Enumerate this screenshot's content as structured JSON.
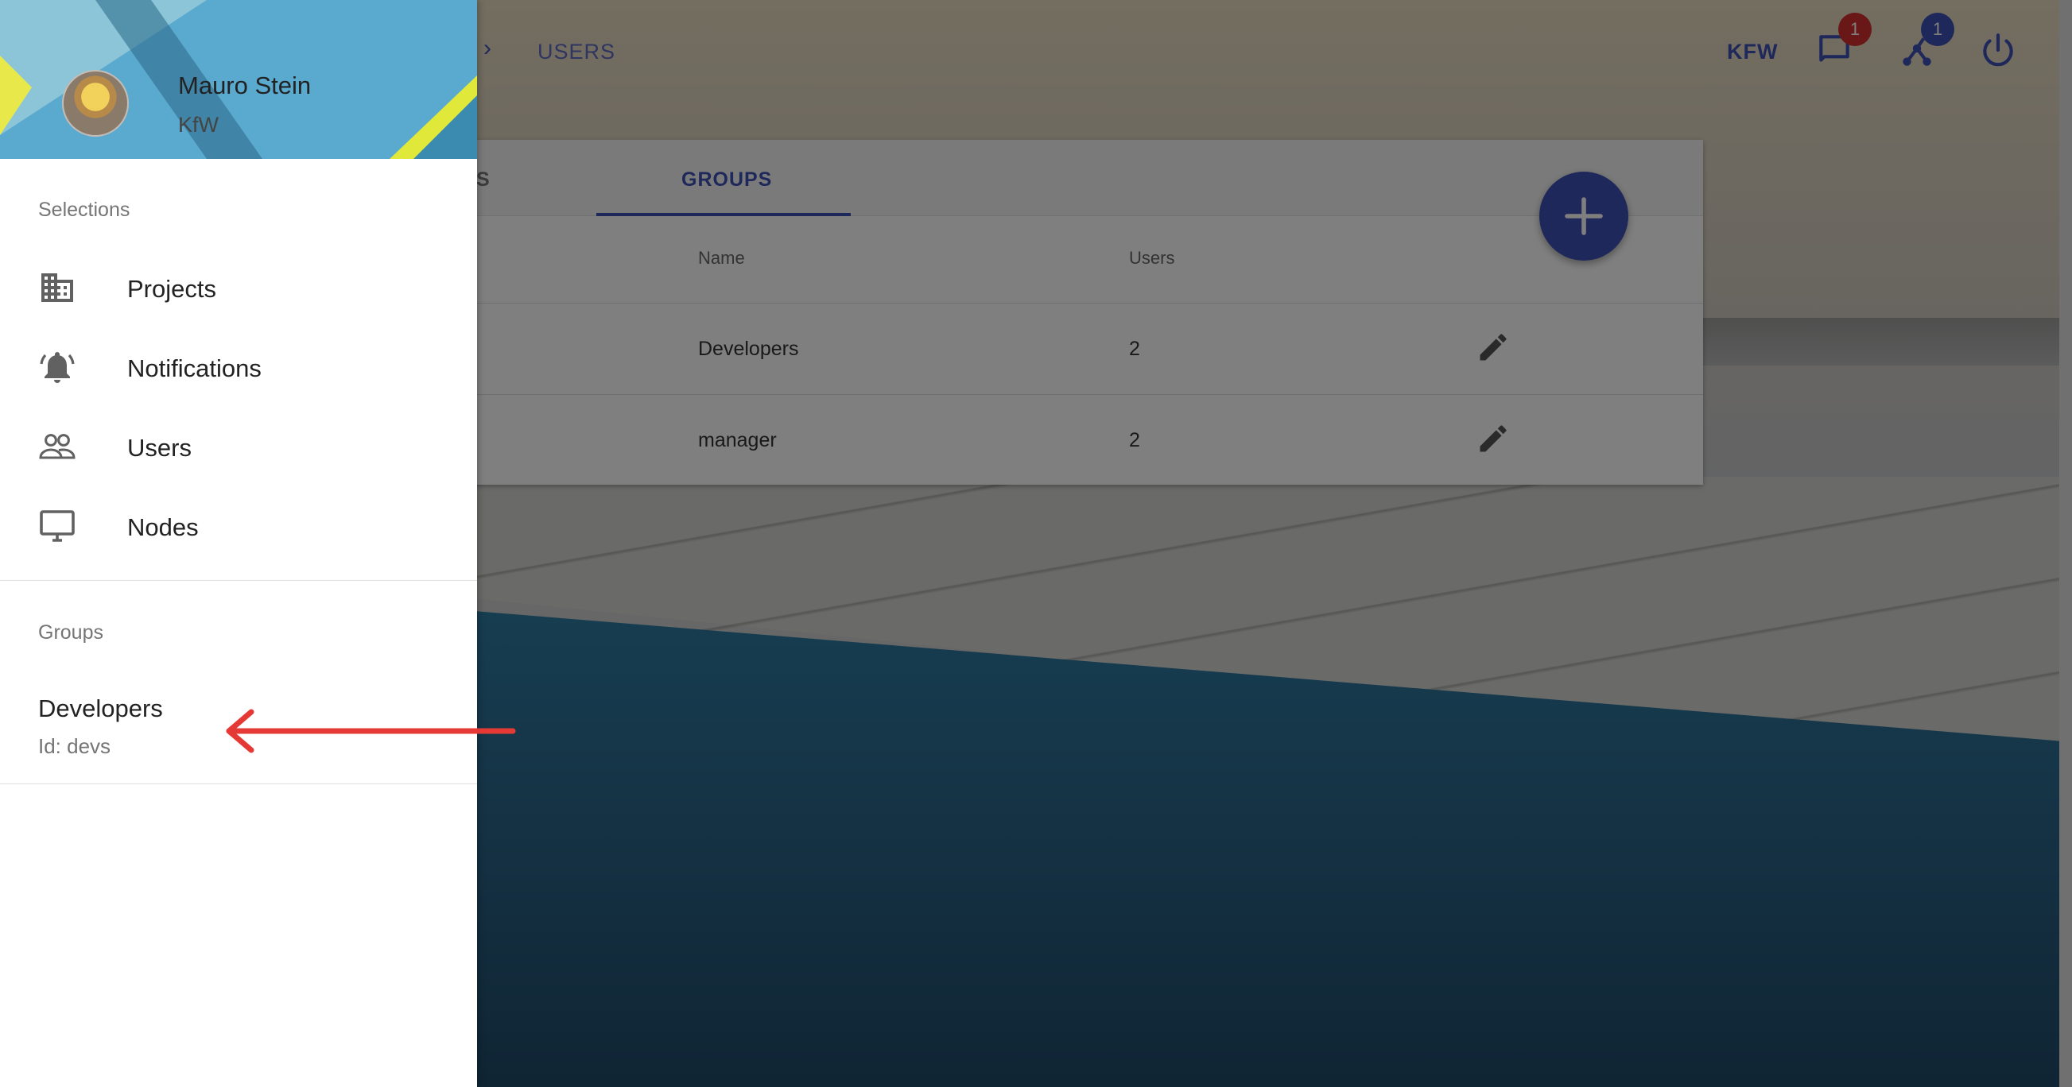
{
  "header": {
    "breadcrumb_current": "USERS",
    "org_label": "KFW",
    "notifications_badge": "1",
    "peers_badge": "1"
  },
  "tabs": [
    {
      "label": "RS"
    },
    {
      "label": "GROUPS"
    }
  ],
  "table": {
    "columns": [
      "Name",
      "Users"
    ],
    "rows": [
      {
        "name": "Developers",
        "users": "2"
      },
      {
        "name": "manager",
        "users": "2"
      }
    ]
  },
  "drawer": {
    "user_name": "Mauro Stein",
    "user_org": "KfW",
    "selections_label": "Selections",
    "menu": [
      {
        "label": "Projects",
        "icon": "business-icon"
      },
      {
        "label": "Notifications",
        "icon": "alarm-icon"
      },
      {
        "label": "Users",
        "icon": "people-icon"
      },
      {
        "label": "Nodes",
        "icon": "desktop-icon"
      }
    ],
    "groups_label": "Groups",
    "groups": [
      {
        "name": "Developers",
        "id": "Id: devs"
      }
    ]
  },
  "colors": {
    "primary": "#3f51b5",
    "badge_red": "#d32f2f",
    "annotation_arrow": "#e53935"
  }
}
